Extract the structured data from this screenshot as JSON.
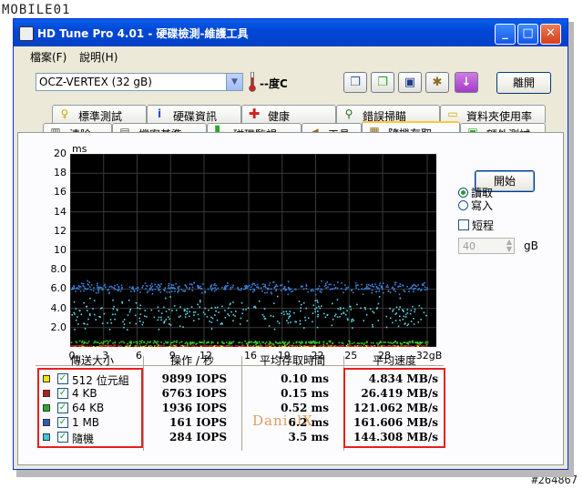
{
  "watermark": {
    "top_logo": "MOBILE01",
    "bottom_id": "#264867",
    "author": "DanielX"
  },
  "window": {
    "title": "HD Tune Pro 4.01 - 硬碟檢測-維護工具",
    "min": "_",
    "max": "□",
    "close": "✕"
  },
  "menu": [
    "檔案(F)",
    "說明(H)"
  ],
  "toolbar": {
    "drive": "OCZ-VERTEX (32 gB)",
    "temperature": "--度C",
    "exit_label": "離開",
    "icons": [
      "copy-info-icon",
      "copy-screen-icon",
      "save-icon",
      "options-icon",
      "down-arrow-icon"
    ]
  },
  "tabs_row1": [
    {
      "label": "標準測試",
      "icon": "bulb-icon"
    },
    {
      "label": "硬碟資訊",
      "icon": "info-icon"
    },
    {
      "label": "健康",
      "icon": "health-cross-icon"
    },
    {
      "label": "錯誤掃瞄",
      "icon": "magnifier-icon"
    },
    {
      "label": "資料夾使用率",
      "icon": "folder-icon"
    }
  ],
  "tabs_row2": [
    {
      "label": "清除",
      "icon": "trash-icon"
    },
    {
      "label": "檔案基準",
      "icon": "file-icon"
    },
    {
      "label": "磁碟監視",
      "icon": "monitor-chart-icon"
    },
    {
      "label": "工具",
      "icon": "speaker-tool-icon"
    },
    {
      "label": "隨機存取",
      "icon": "random-access-icon",
      "active": true
    },
    {
      "label": "額外測試",
      "icon": "extra-test-icon"
    }
  ],
  "controls": {
    "start": "開始",
    "read": "讀取",
    "write": "寫入",
    "short": "短程",
    "short_size": "40",
    "size_unit": "gB"
  },
  "chart_data": {
    "type": "scatter",
    "y_unit": "ms",
    "x_unit": "gB",
    "ylim": [
      0,
      20
    ],
    "xlim": [
      0,
      32
    ],
    "y_ticks": [
      "20",
      "18",
      "16",
      "14",
      "12",
      "10",
      "8.0",
      "6.0",
      "4.0",
      "2.0"
    ],
    "x_ticks": [
      "0",
      "3",
      "6",
      "9",
      "12",
      "16",
      "19",
      "22",
      "25",
      "28",
      "32gB"
    ],
    "series": [
      {
        "name": "512 位元組",
        "color": "#e8e800",
        "y_center": 0.1
      },
      {
        "name": "4 KB",
        "color": "#c81e1e",
        "y_center": 0.15
      },
      {
        "name": "64 KB",
        "color": "#2ec82e",
        "y_center": 0.52
      },
      {
        "name": "1 MB",
        "color": "#3c82dc",
        "y_center": 6.2
      },
      {
        "name": "隨機",
        "color": "#5ad2e6",
        "y_center": 3.5
      }
    ]
  },
  "table": {
    "headers": [
      "傳送大小",
      "操作 / 秒",
      "平均存取時間",
      "平均速度"
    ],
    "rows": [
      {
        "size": "512 位元組",
        "color": "#f0e600",
        "iops": "9899 IOPS",
        "access": "0.10 ms",
        "speed": "4.834 MB/s"
      },
      {
        "size": "4 KB",
        "color": "#b41e1e",
        "iops": "6763 IOPS",
        "access": "0.15 ms",
        "speed": "26.419 MB/s"
      },
      {
        "size": "64 KB",
        "color": "#2ca82c",
        "iops": "1936 IOPS",
        "access": "0.52 ms",
        "speed": "121.062 MB/s"
      },
      {
        "size": "1 MB",
        "color": "#2b5fb4",
        "iops": "161 IOPS",
        "access": "6.2 ms",
        "speed": "161.606 MB/s"
      },
      {
        "size": "隨機",
        "color": "#3cc8dc",
        "iops": "284 IOPS",
        "access": "3.5 ms",
        "speed": "144.308 MB/s"
      }
    ]
  }
}
